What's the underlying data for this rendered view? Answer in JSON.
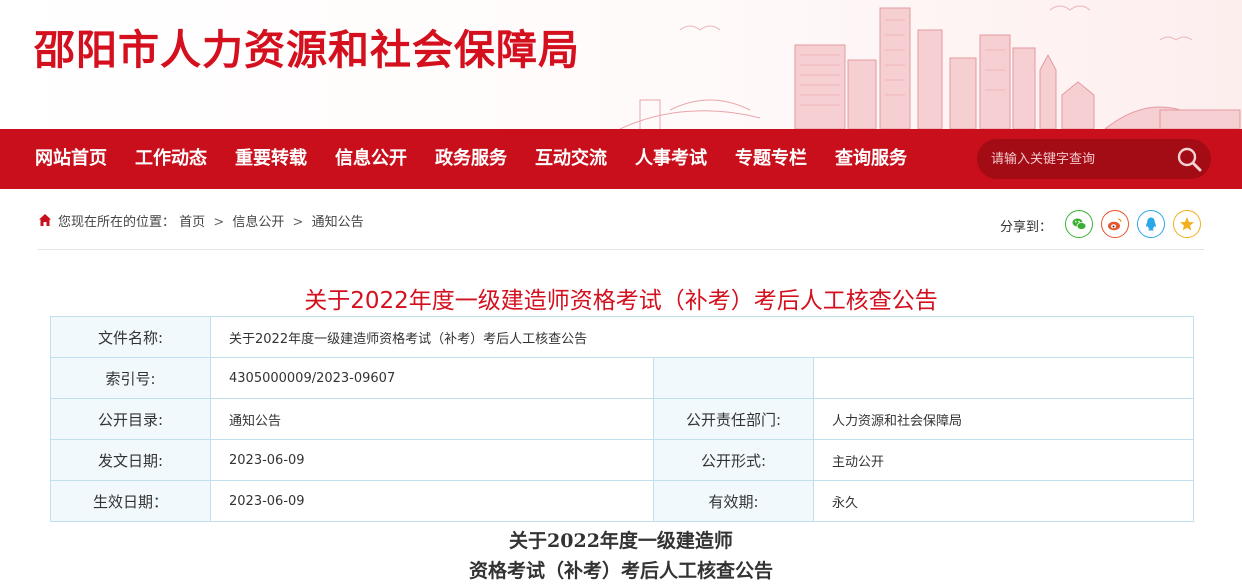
{
  "header": {
    "site_title": "邵阳市人力资源和社会保障局"
  },
  "nav": {
    "items": [
      "网站首页",
      "工作动态",
      "重要转载",
      "信息公开",
      "政务服务",
      "互动交流",
      "人事考试",
      "专题专栏",
      "查询服务"
    ],
    "search_placeholder": "请输入关键字查询"
  },
  "breadcrumb": {
    "prefix": "您现在所在的位置：",
    "items": [
      "首页",
      "信息公开",
      "通知公告"
    ],
    "separator": ">"
  },
  "share": {
    "label": "分享到：",
    "icons": [
      "wechat-icon",
      "weibo-icon",
      "qq-icon",
      "qzone-icon"
    ]
  },
  "document": {
    "title": "关于2022年度一级建造师资格考试（补考）考后人工核查公告",
    "meta": {
      "file_name_label": "文件名称:",
      "file_name": "关于2022年度一级建造师资格考试（补考）考后人工核查公告",
      "index_label": "索引号:",
      "index": "4305000009/2023-09607",
      "catalog_label": "公开目录:",
      "catalog": "通知公告",
      "dept_label": "公开责任部门:",
      "dept": "人力资源和社会保障局",
      "issue_date_label": "发文日期:",
      "issue_date": "2023-06-09",
      "form_label": "公开形式:",
      "form": "主动公开",
      "effective_date_label": "生效日期：",
      "effective_date": "2023-06-09",
      "validity_label": "有效期:",
      "validity": "永久"
    },
    "body_heading_line1": "关于2022年度一级建造师",
    "body_heading_line2": "资格考试（补考）考后人工核查公告"
  },
  "colors": {
    "brand_red": "#d4101f",
    "nav_red": "#c80f1b",
    "table_border": "#bfe0ec",
    "label_bg": "#f2f9fc"
  }
}
